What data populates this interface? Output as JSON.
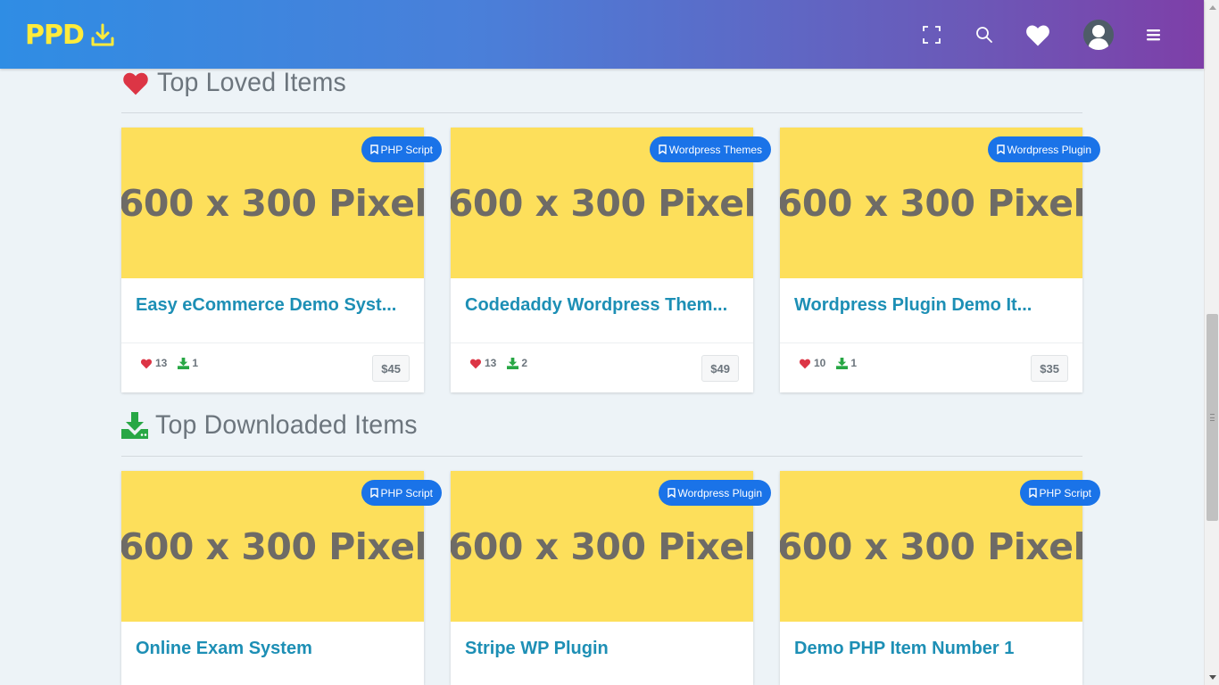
{
  "header": {
    "logo_text": "PPD",
    "icons": [
      "fullscreen-icon",
      "search-icon",
      "heart-icon",
      "user-avatar",
      "menu-icon"
    ]
  },
  "colors": {
    "header_gradient_start": "#2f8de4",
    "header_gradient_end": "#7e3fa8",
    "logo_yellow": "#ffeb3b",
    "badge_blue": "#1a73e8",
    "title_link": "#1d8fb5",
    "heart_red": "#dc3545",
    "download_green": "#28a745",
    "placeholder_yellow": "#fddf5b"
  },
  "loved": {
    "title": "Top Loved Items",
    "items": [
      {
        "image_text": "600 x 300 Pixel",
        "category": "PHP Script",
        "title": "Easy eCommerce Demo Syst...",
        "loves": "13",
        "downloads": "1",
        "price": "$45"
      },
      {
        "image_text": "600 x 300 Pixel",
        "category": "Wordpress Themes",
        "title": "Codedaddy Wordpress Them...",
        "loves": "13",
        "downloads": "2",
        "price": "$49"
      },
      {
        "image_text": "600 x 300 Pixel",
        "category": "Wordpress Plugin",
        "title": "Wordpress Plugin Demo It...",
        "loves": "10",
        "downloads": "1",
        "price": "$35"
      }
    ]
  },
  "downloaded": {
    "title": "Top Downloaded Items",
    "items": [
      {
        "image_text": "600 x 300 Pixel",
        "category": "PHP Script",
        "title": "Online Exam System"
      },
      {
        "image_text": "600 x 300 Pixel",
        "category": "Wordpress Plugin",
        "title": "Stripe WP Plugin"
      },
      {
        "image_text": "600 x 300 Pixel",
        "category": "PHP Script",
        "title": "Demo PHP Item Number 1"
      }
    ]
  }
}
